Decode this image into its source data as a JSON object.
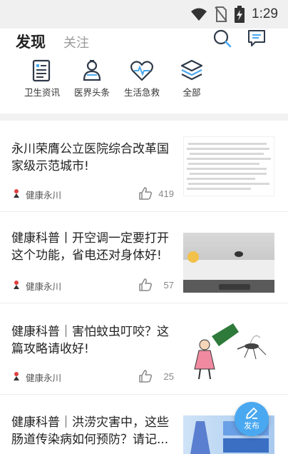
{
  "status_bar": {
    "time": "1:29"
  },
  "header": {
    "tab_discover": "发现",
    "tab_follow": "关注",
    "search_icon": "search-icon",
    "message_icon": "message-icon"
  },
  "categories": [
    {
      "label": "卫生资讯",
      "icon": "news-icon"
    },
    {
      "label": "医界头条",
      "icon": "doctor-icon"
    },
    {
      "label": "生活急救",
      "icon": "heartbeat-icon"
    },
    {
      "label": "全部",
      "icon": "layers-icon"
    }
  ],
  "news": [
    {
      "title": "永川荣膺公立医院综合改革国家级示范城市!",
      "author": "健康永川",
      "likes": "419"
    },
    {
      "title": "健康科普丨开空调一定要打开这个功能，省电还对身体好!",
      "author": "健康永川",
      "likes": "57"
    },
    {
      "title": "健康科普｜害怕蚊虫叮咬？这篇攻略请收好!",
      "author": "健康永川",
      "likes": "25"
    },
    {
      "title": "健康科普｜洪涝灾害中，这些肠道传染病如何预防？请记...",
      "author": "",
      "likes": ""
    }
  ],
  "fab": {
    "label": "发布"
  },
  "colors": {
    "accent": "#4aa8f0",
    "icon_dark": "#2f3a4a",
    "muted": "#9a9a9a"
  }
}
